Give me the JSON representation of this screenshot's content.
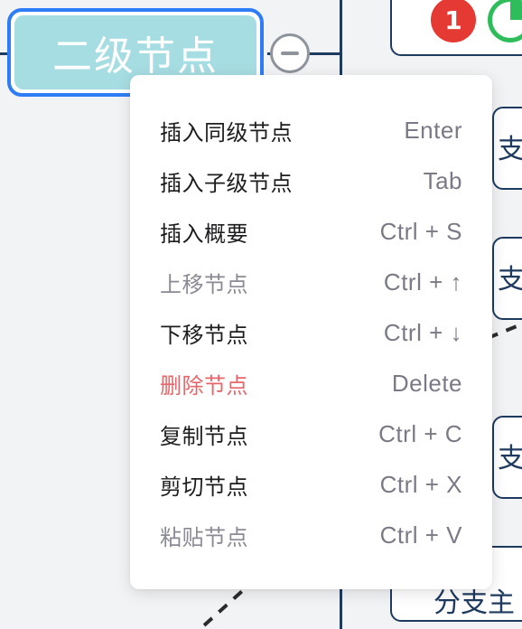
{
  "mindmap": {
    "selected_node_label": "二级节点",
    "notification_count": "1",
    "branch_label_right": "支主",
    "branch_label_bottom": "分支主",
    "colors": {
      "selected_border": "#2f7df6",
      "selected_fill": "#a6dde2",
      "connector": "#1f3a5f",
      "badge_red": "#e43a33",
      "progress_green": "#2ebd5a"
    }
  },
  "context_menu": {
    "items": [
      {
        "label": "插入同级节点",
        "shortcut": "Enter",
        "state": "normal"
      },
      {
        "label": "插入子级节点",
        "shortcut": "Tab",
        "state": "normal"
      },
      {
        "label": "插入概要",
        "shortcut": "Ctrl + S",
        "state": "normal"
      },
      {
        "label": "上移节点",
        "shortcut": "Ctrl + ↑",
        "state": "disabled"
      },
      {
        "label": "下移节点",
        "shortcut": "Ctrl + ↓",
        "state": "normal"
      },
      {
        "label": "删除节点",
        "shortcut": "Delete",
        "state": "danger"
      },
      {
        "label": "复制节点",
        "shortcut": "Ctrl + C",
        "state": "normal"
      },
      {
        "label": "剪切节点",
        "shortcut": "Ctrl + X",
        "state": "normal"
      },
      {
        "label": "粘贴节点",
        "shortcut": "Ctrl + V",
        "state": "disabled"
      }
    ],
    "colors": {
      "danger_text": "#e8666a",
      "disabled_text": "#8a8a95",
      "shortcut_text": "#7a7a86"
    }
  }
}
